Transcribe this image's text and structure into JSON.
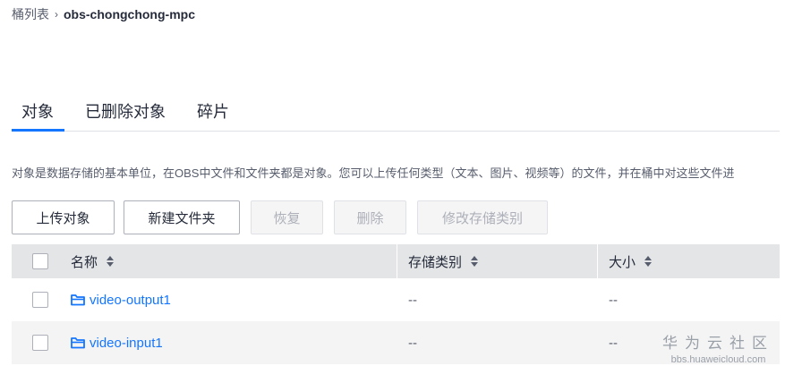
{
  "breadcrumb": {
    "parent": "桶列表",
    "separator": "›",
    "current": "obs-chongchong-mpc"
  },
  "tabs": [
    {
      "label": "对象",
      "active": true
    },
    {
      "label": "已删除对象",
      "active": false
    },
    {
      "label": "碎片",
      "active": false
    }
  ],
  "description": "对象是数据存储的基本单位，在OBS中文件和文件夹都是对象。您可以上传任何类型（文本、图片、视频等）的文件，并在桶中对这些文件进",
  "toolbar": {
    "upload": "上传对象",
    "new_folder": "新建文件夹",
    "restore": "恢复",
    "delete": "删除",
    "change_storage": "修改存储类别"
  },
  "table": {
    "headers": {
      "name": "名称",
      "storage_class": "存储类别",
      "size": "大小"
    },
    "rows": [
      {
        "name": "video-output1",
        "storage_class": "--",
        "size": "--"
      },
      {
        "name": "video-input1",
        "storage_class": "--",
        "size": "--"
      }
    ]
  },
  "watermark": {
    "title": "华为云社区",
    "url": "bbs.huaweicloud.com"
  },
  "colors": {
    "accent": "#1476ff",
    "header_bg": "#e4e5e7",
    "alt_row_bg": "#f4f4f5"
  }
}
